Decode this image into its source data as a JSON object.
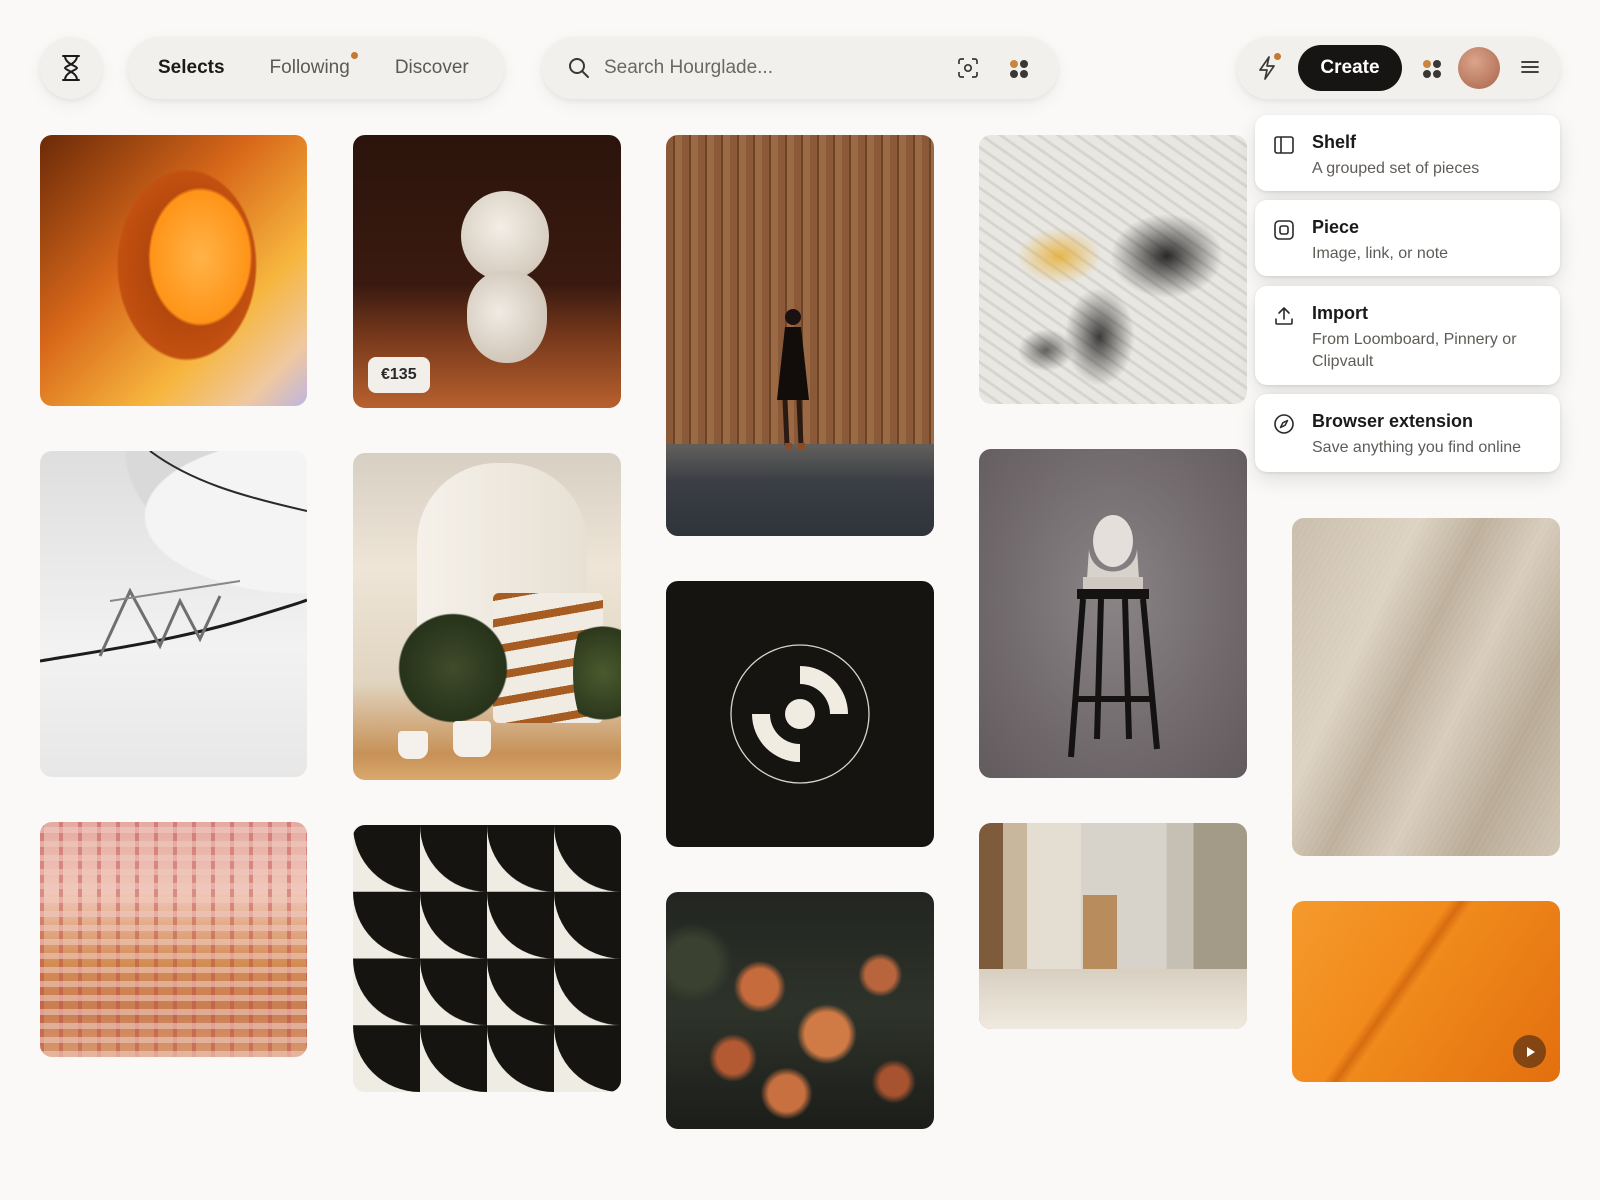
{
  "app": {
    "logo_icon": "hourglass-icon"
  },
  "nav": {
    "tabs": [
      {
        "label": "Selects",
        "active": true
      },
      {
        "label": "Following",
        "has_notification": true
      },
      {
        "label": "Discover"
      }
    ]
  },
  "search": {
    "placeholder": "Search Hourglade...",
    "value": "",
    "icons": [
      "search-icon",
      "visual-search-icon",
      "apps-icon"
    ]
  },
  "header_actions": {
    "create_label": "Create",
    "icons": [
      "bolt-icon",
      "apps-icon",
      "avatar",
      "menu-icon"
    ],
    "notification_color": "#c7772e"
  },
  "create_menu": {
    "items": [
      {
        "title": "Shelf",
        "description": "A grouped set of pieces",
        "icon": "shelf-icon"
      },
      {
        "title": "Piece",
        "description": "Image, link, or note",
        "icon": "piece-icon"
      },
      {
        "title": "Import",
        "description": "From Loomboard, Pinnery or Clipvault",
        "icon": "upload-icon"
      },
      {
        "title": "Browser extension",
        "description": "Save anything you find online",
        "icon": "compass-icon"
      }
    ]
  },
  "tiles": {
    "vase_price": "€135"
  },
  "colors": {
    "background": "#faf9f7",
    "pill": "#f1f0ed",
    "create_button": "#161513",
    "accent_dot": "#c7772e"
  }
}
